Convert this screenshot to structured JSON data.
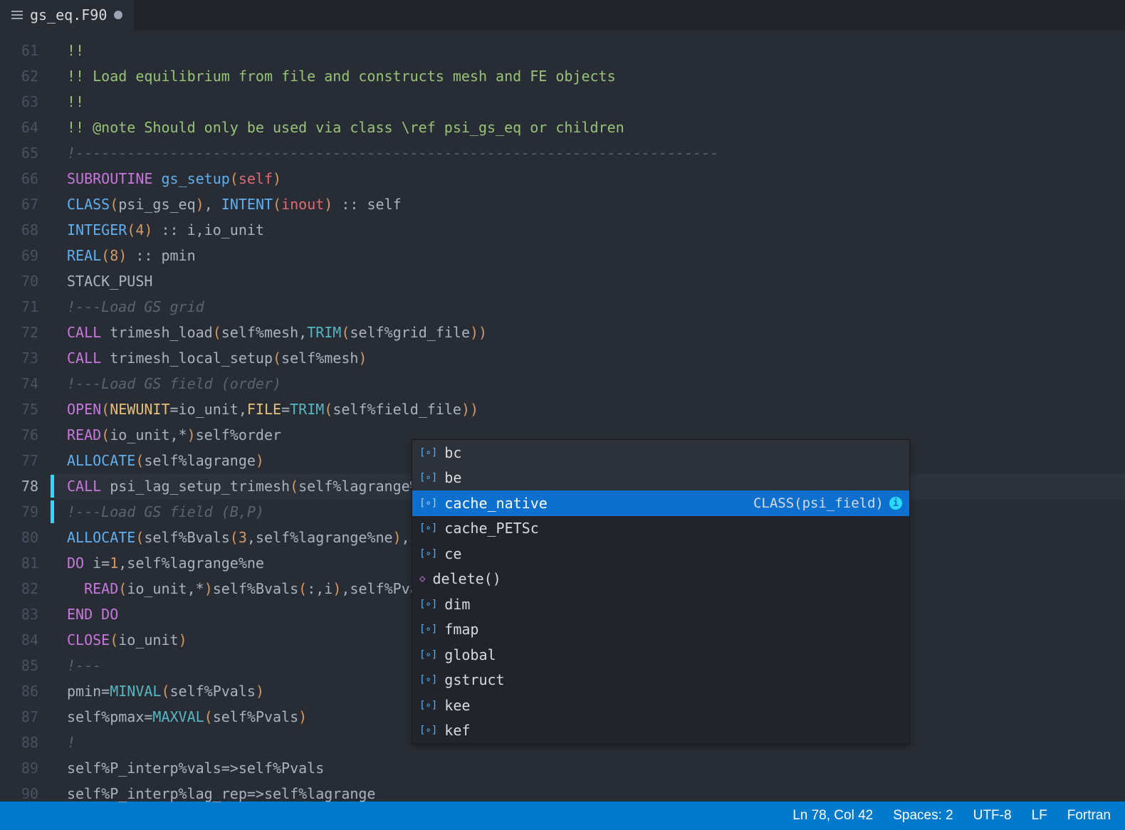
{
  "tab": {
    "filename": "gs_eq.F90"
  },
  "gutter": {
    "start": 61,
    "end": 90,
    "current": 78,
    "modified": [
      78,
      79
    ]
  },
  "lines": {
    "61": [
      [
        "c-doc",
        "!!"
      ]
    ],
    "62": [
      [
        "c-doc",
        "!! Load equilibrium from file and constructs mesh and FE objects"
      ]
    ],
    "63": [
      [
        "c-doc",
        "!!"
      ]
    ],
    "64": [
      [
        "c-doc",
        "!! @note Should only be used via class \\ref psi_gs_eq or children"
      ]
    ],
    "65": [
      [
        "c-comment",
        "!---------------------------------------------------------------------------"
      ]
    ],
    "66": [
      [
        "c-key",
        "SUBROUTINE"
      ],
      [
        "c-var",
        " "
      ],
      [
        "c-func",
        "gs_setup"
      ],
      [
        "c-paren",
        "("
      ],
      [
        "c-self",
        "self"
      ],
      [
        "c-paren",
        ")"
      ]
    ],
    "67": [
      [
        "c-type",
        "CLASS"
      ],
      [
        "c-paren",
        "("
      ],
      [
        "c-var",
        "psi_gs_eq"
      ],
      [
        "c-paren",
        ")"
      ],
      [
        "c-var",
        ", "
      ],
      [
        "c-type",
        "INTENT"
      ],
      [
        "c-paren",
        "("
      ],
      [
        "c-self",
        "inout"
      ],
      [
        "c-paren",
        ")"
      ],
      [
        "c-var",
        " :: self"
      ]
    ],
    "68": [
      [
        "c-type",
        "INTEGER"
      ],
      [
        "c-paren",
        "("
      ],
      [
        "c-num",
        "4"
      ],
      [
        "c-paren",
        ")"
      ],
      [
        "c-var",
        " :: i,io_unit"
      ]
    ],
    "69": [
      [
        "c-type",
        "REAL"
      ],
      [
        "c-paren",
        "("
      ],
      [
        "c-num",
        "8"
      ],
      [
        "c-paren",
        ")"
      ],
      [
        "c-var",
        " :: pmin"
      ]
    ],
    "70": [
      [
        "c-var",
        "STACK_PUSH"
      ]
    ],
    "71": [
      [
        "c-comment",
        "!---Load GS grid"
      ]
    ],
    "72": [
      [
        "c-key",
        "CALL"
      ],
      [
        "c-var",
        " trimesh_load"
      ],
      [
        "c-paren",
        "("
      ],
      [
        "c-var",
        "self%mesh,"
      ],
      [
        "c-call",
        "TRIM"
      ],
      [
        "c-paren",
        "("
      ],
      [
        "c-var",
        "self%grid_file"
      ],
      [
        "c-paren",
        "))"
      ]
    ],
    "73": [
      [
        "c-key",
        "CALL"
      ],
      [
        "c-var",
        " trimesh_local_setup"
      ],
      [
        "c-paren",
        "("
      ],
      [
        "c-var",
        "self%mesh"
      ],
      [
        "c-paren",
        ")"
      ]
    ],
    "74": [
      [
        "c-comment",
        "!---Load GS field (order)"
      ]
    ],
    "75": [
      [
        "c-key",
        "OPEN"
      ],
      [
        "c-paren",
        "("
      ],
      [
        "c-attr",
        "NEWUNIT"
      ],
      [
        "c-var",
        "=io_unit,"
      ],
      [
        "c-attr",
        "FILE"
      ],
      [
        "c-var",
        "="
      ],
      [
        "c-call",
        "TRIM"
      ],
      [
        "c-paren",
        "("
      ],
      [
        "c-var",
        "self%field_file"
      ],
      [
        "c-paren",
        "))"
      ]
    ],
    "76": [
      [
        "c-key",
        "READ"
      ],
      [
        "c-paren",
        "("
      ],
      [
        "c-var",
        "io_unit,*"
      ],
      [
        "c-paren",
        ")"
      ],
      [
        "c-var",
        "self%order"
      ]
    ],
    "77": [
      [
        "c-type",
        "ALLOCATE"
      ],
      [
        "c-paren",
        "("
      ],
      [
        "c-var",
        "self%lagrange"
      ],
      [
        "c-paren",
        ")"
      ]
    ],
    "78": [
      [
        "c-key",
        "CALL"
      ],
      [
        "c-var",
        " psi_lag_setup_trimesh"
      ],
      [
        "c-paren",
        "("
      ],
      [
        "c-var",
        "self%lagrange%"
      ]
    ],
    "79": [
      [
        "c-comment",
        "!---Load GS field (B,P)"
      ]
    ],
    "80": [
      [
        "c-type",
        "ALLOCATE"
      ],
      [
        "c-paren",
        "("
      ],
      [
        "c-var",
        "self%Bvals"
      ],
      [
        "c-paren",
        "("
      ],
      [
        "c-num",
        "3"
      ],
      [
        "c-var",
        ",self%lagrange%ne"
      ],
      [
        "c-paren",
        ")"
      ],
      [
        "c-var",
        ",s"
      ]
    ],
    "81": [
      [
        "c-key",
        "DO"
      ],
      [
        "c-var",
        " i="
      ],
      [
        "c-num",
        "1"
      ],
      [
        "c-var",
        ",self%lagrange%ne"
      ]
    ],
    "82": [
      [
        "c-var",
        "  "
      ],
      [
        "c-key",
        "READ"
      ],
      [
        "c-paren",
        "("
      ],
      [
        "c-var",
        "io_unit,*"
      ],
      [
        "c-paren",
        ")"
      ],
      [
        "c-var",
        "self%Bvals"
      ],
      [
        "c-paren",
        "("
      ],
      [
        "c-var",
        ":,i"
      ],
      [
        "c-paren",
        ")"
      ],
      [
        "c-var",
        ",self%Pva"
      ]
    ],
    "83": [
      [
        "c-key",
        "END DO"
      ]
    ],
    "84": [
      [
        "c-key",
        "CLOSE"
      ],
      [
        "c-paren",
        "("
      ],
      [
        "c-var",
        "io_unit"
      ],
      [
        "c-paren",
        ")"
      ]
    ],
    "85": [
      [
        "c-comment",
        "!---"
      ]
    ],
    "86": [
      [
        "c-var",
        "pmin="
      ],
      [
        "c-call",
        "MINVAL"
      ],
      [
        "c-paren",
        "("
      ],
      [
        "c-var",
        "self%Pvals"
      ],
      [
        "c-paren",
        ")"
      ]
    ],
    "87": [
      [
        "c-var",
        "self%pmax="
      ],
      [
        "c-call",
        "MAXVAL"
      ],
      [
        "c-paren",
        "("
      ],
      [
        "c-var",
        "self%Pvals"
      ],
      [
        "c-paren",
        ")"
      ]
    ],
    "88": [
      [
        "c-comment",
        "!"
      ]
    ],
    "89": [
      [
        "c-var",
        "self%P_interp%vals=>self%Pvals"
      ]
    ],
    "90": [
      [
        "c-var",
        "self%P_interp%lag_rep=>self%lagrange"
      ]
    ]
  },
  "suggest": {
    "selectedIndex": 2,
    "items": [
      {
        "icon": "field",
        "label": "bc",
        "detail": ""
      },
      {
        "icon": "field",
        "label": "be",
        "detail": ""
      },
      {
        "icon": "field",
        "label": "cache_native",
        "detail": "CLASS(psi_field)"
      },
      {
        "icon": "field",
        "label": "cache_PETSc",
        "detail": ""
      },
      {
        "icon": "field",
        "label": "ce",
        "detail": ""
      },
      {
        "icon": "method",
        "label": "delete()",
        "detail": ""
      },
      {
        "icon": "field",
        "label": "dim",
        "detail": ""
      },
      {
        "icon": "field",
        "label": "fmap",
        "detail": ""
      },
      {
        "icon": "field",
        "label": "global",
        "detail": ""
      },
      {
        "icon": "field",
        "label": "gstruct",
        "detail": ""
      },
      {
        "icon": "field",
        "label": "kee",
        "detail": ""
      },
      {
        "icon": "field",
        "label": "kef",
        "detail": ""
      }
    ]
  },
  "status": {
    "position": "Ln 78, Col 42",
    "spaces": "Spaces: 2",
    "encoding": "UTF-8",
    "eol": "LF",
    "language": "Fortran"
  }
}
